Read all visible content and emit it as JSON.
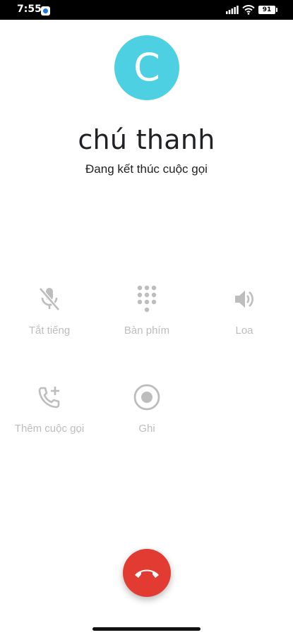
{
  "status_bar": {
    "time": "7:55",
    "battery": "91"
  },
  "contact": {
    "initial": "C",
    "name": "chú thanh",
    "status": "Đang kết thúc cuộc gọi",
    "avatar_color": "#4dd0e1"
  },
  "controls": {
    "mute": {
      "label": "Tắt tiếng",
      "icon": "mic-off-icon"
    },
    "keypad": {
      "label": "Bàn phím",
      "icon": "dialpad-icon"
    },
    "speaker": {
      "label": "Loa",
      "icon": "volume-icon"
    },
    "add_call": {
      "label": "Thêm cuộc gọi",
      "icon": "add-call-icon"
    },
    "record": {
      "label": "Ghi",
      "icon": "record-icon"
    }
  },
  "end_call": {
    "icon": "end-call-icon",
    "color": "#e23b32"
  }
}
